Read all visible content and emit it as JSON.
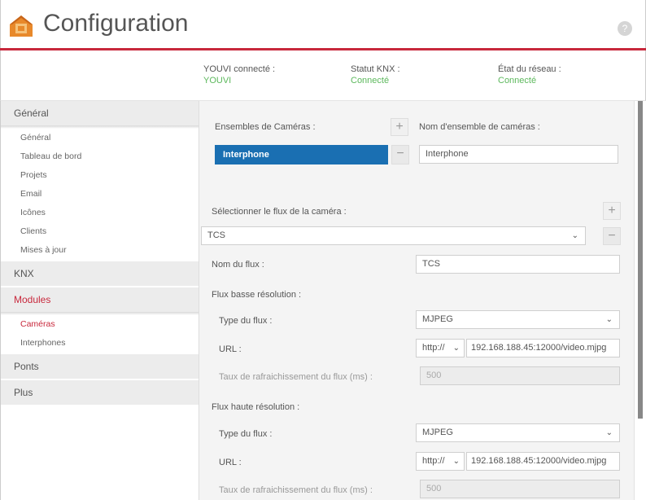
{
  "header": {
    "title": "Configuration",
    "help_icon": "?"
  },
  "status": {
    "youvi": {
      "label": "YOUVI connecté :",
      "value": "YOUVI"
    },
    "knx": {
      "label": "Statut KNX :",
      "value": "Connecté"
    },
    "network": {
      "label": "État du réseau :",
      "value": "Connecté"
    },
    "value_color": "#5cb85c"
  },
  "sidebar": {
    "general": {
      "label": "Général",
      "items": [
        "Général",
        "Tableau de bord",
        "Projets",
        "Email",
        "Icônes",
        "Clients",
        "Mises à jour"
      ]
    },
    "knx": {
      "label": "KNX"
    },
    "modules": {
      "label": "Modules",
      "items": [
        "Caméras",
        "Interphones"
      ]
    },
    "ponts": {
      "label": "Ponts"
    },
    "plus": {
      "label": "Plus"
    }
  },
  "main": {
    "camera_sets": {
      "label": "Ensembles de Caméras :",
      "items": [
        "Interphone"
      ],
      "name_label": "Nom d'ensemble de caméras :",
      "name_value": "Interphone"
    },
    "stream": {
      "select_label": "Sélectionner le flux de la caméra :",
      "selected": "TCS",
      "name_label": "Nom du flux :",
      "name_value": "TCS"
    },
    "low_res": {
      "heading": "Flux basse résolution :",
      "type_label": "Type du flux :",
      "type_value": "MJPEG",
      "url_label": "URL :",
      "protocol": "http://",
      "url_value": "192.168.188.45:12000/video.mjpg",
      "refresh_label": "Taux de rafraichissement du flux (ms) :",
      "refresh_value": "500"
    },
    "high_res": {
      "heading": "Flux haute résolution :",
      "type_label": "Type du flux :",
      "type_value": "MJPEG",
      "url_label": "URL :",
      "protocol": "http://",
      "url_value": "192.168.188.45:12000/video.mjpg",
      "refresh_label": "Taux de rafraichissement du flux (ms) :",
      "refresh_value": "500"
    }
  },
  "colors": {
    "accent_red": "#c8283c",
    "selected_blue": "#1a6fb2"
  }
}
